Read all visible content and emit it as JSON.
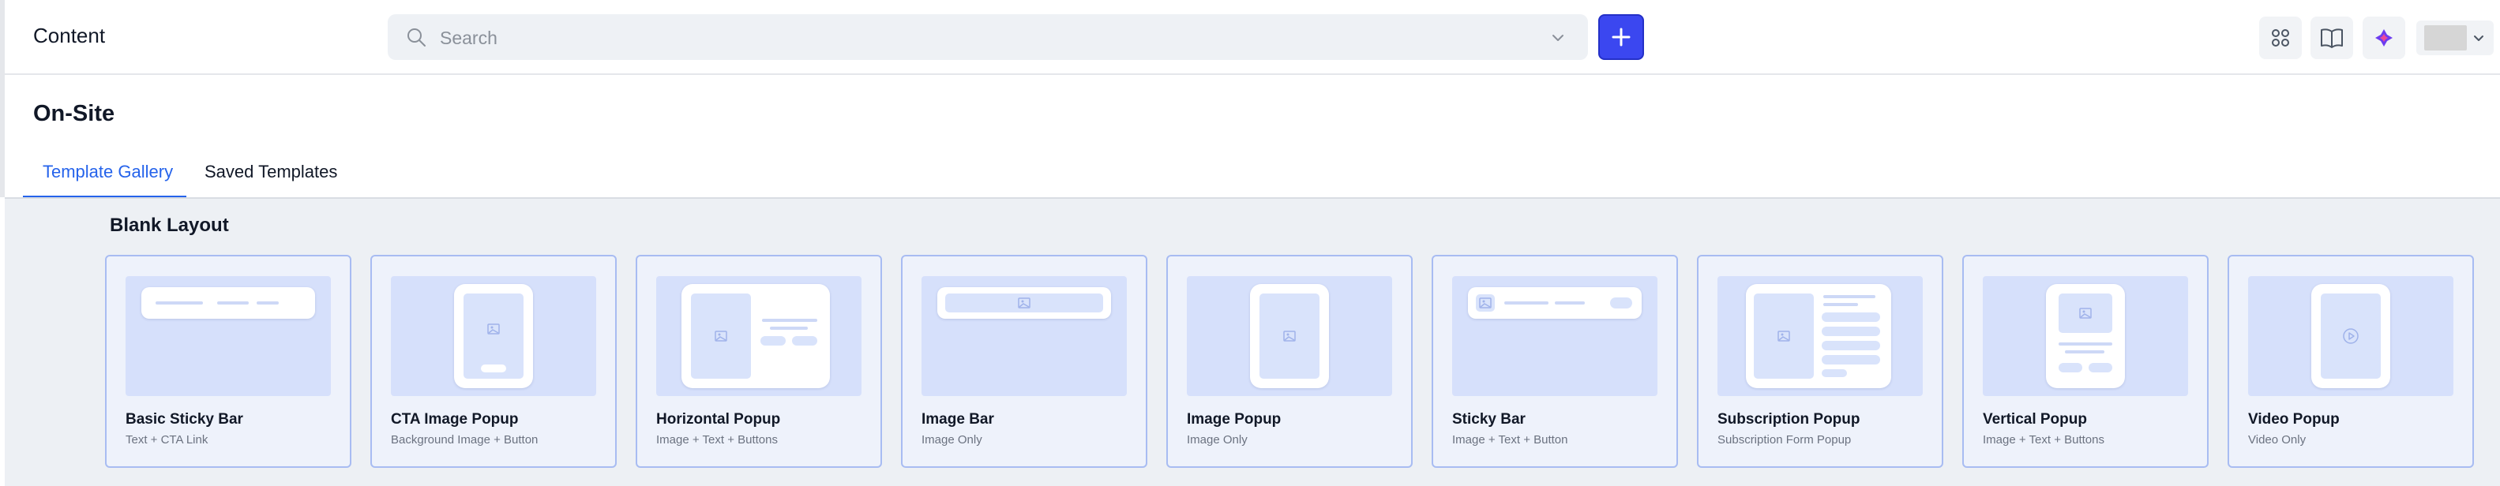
{
  "header": {
    "app_title": "Content",
    "search_placeholder": "Search",
    "add_button_icon": "plus-icon",
    "actions": [
      {
        "name": "apps-grid",
        "icon": "grid-icon"
      },
      {
        "name": "docs",
        "icon": "book-icon"
      },
      {
        "name": "assistant",
        "icon": "sparkle-icon"
      }
    ],
    "accent_color": "#3b47f0"
  },
  "page": {
    "title": "On-Site",
    "tabs": [
      {
        "label": "Template Gallery",
        "active": true
      },
      {
        "label": "Saved Templates",
        "active": false
      }
    ]
  },
  "gallery": {
    "section_title": "Blank Layout",
    "cards": [
      {
        "title": "Basic Sticky Bar",
        "subtitle": "Text + CTA Link"
      },
      {
        "title": "CTA Image Popup",
        "subtitle": "Background Image + Button"
      },
      {
        "title": "Horizontal Popup",
        "subtitle": "Image + Text + Buttons"
      },
      {
        "title": "Image Bar",
        "subtitle": "Image Only"
      },
      {
        "title": "Image Popup",
        "subtitle": "Image Only"
      },
      {
        "title": "Sticky Bar",
        "subtitle": "Image + Text + Button"
      },
      {
        "title": "Subscription Popup",
        "subtitle": "Subscription Form Popup"
      },
      {
        "title": "Vertical Popup",
        "subtitle": "Image + Text + Buttons"
      },
      {
        "title": "Video Popup",
        "subtitle": "Video Only"
      }
    ]
  }
}
